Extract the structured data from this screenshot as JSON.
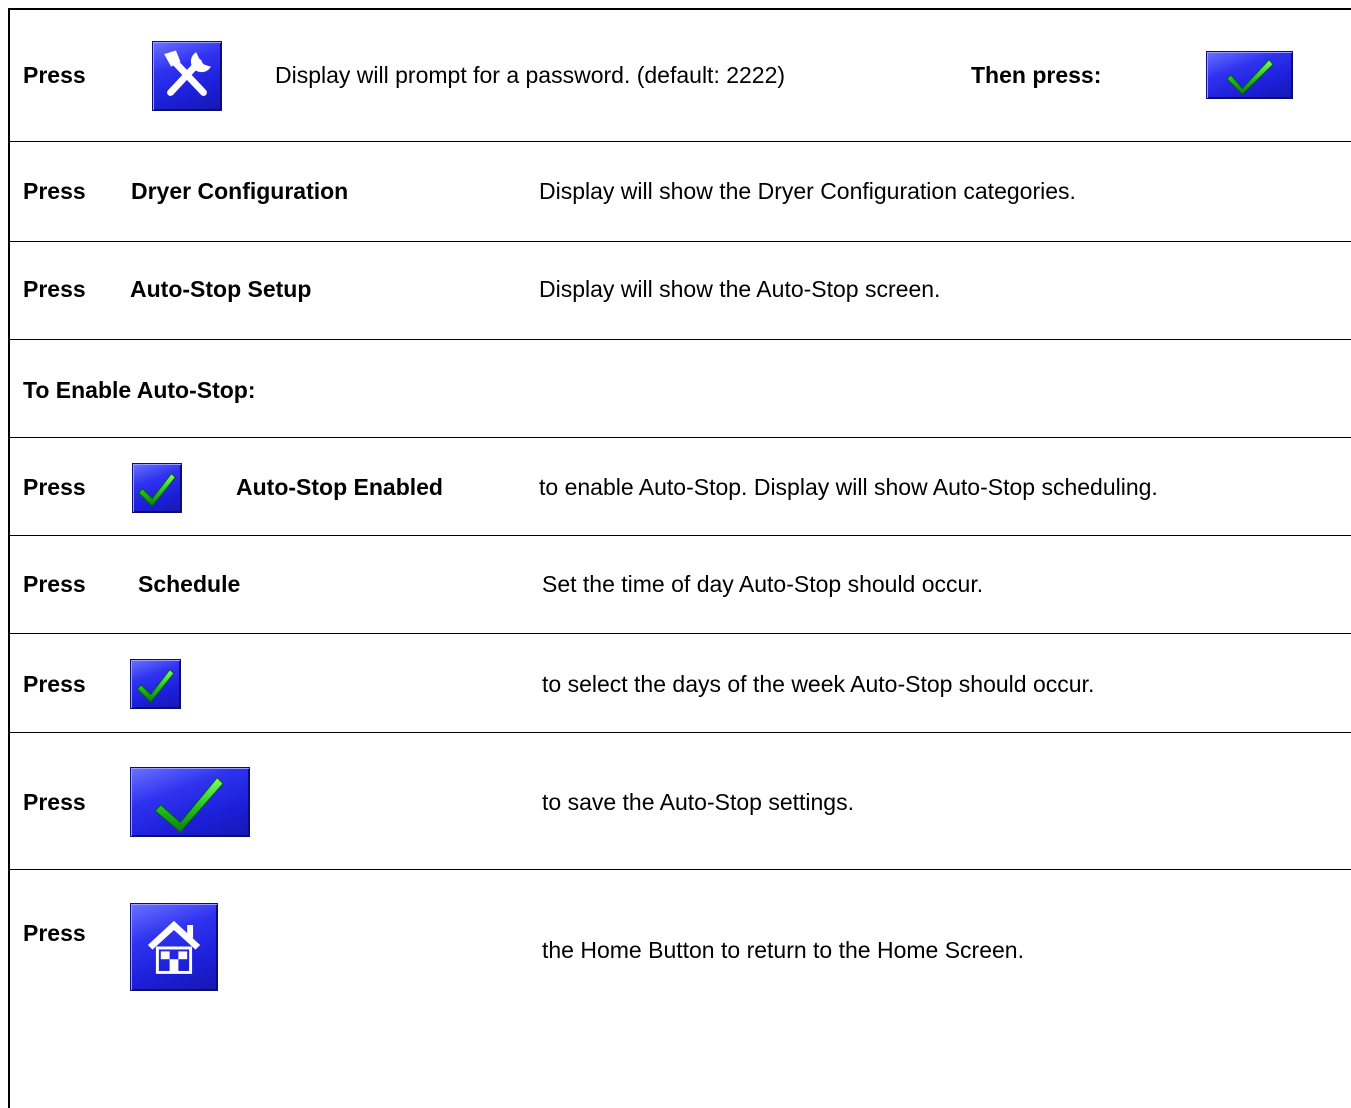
{
  "rows": [
    {
      "press": "Press",
      "desc": "Display will prompt for a password. (default: 2222)",
      "then_press": "Then press:"
    },
    {
      "press": "Press",
      "item": "Dryer Configuration",
      "desc": "Display will show the Dryer Configuration categories."
    },
    {
      "press": "Press",
      "item": "Auto-Stop Setup",
      "desc": "Display will show the Auto-Stop screen."
    },
    {
      "heading": "To Enable Auto-Stop:"
    },
    {
      "press": "Press",
      "item": "Auto-Stop Enabled",
      "desc": "to enable Auto-Stop.  Display will show Auto-Stop scheduling."
    },
    {
      "press": "Press",
      "item": "Schedule",
      "desc": "Set the time of day Auto-Stop should occur."
    },
    {
      "press": "Press",
      "desc": "to select the days of the week Auto-Stop should occur."
    },
    {
      "press": "Press",
      "desc": "to save the Auto-Stop settings."
    },
    {
      "press": "Press",
      "desc": "the Home Button to return to the Home Screen."
    }
  ],
  "icons": {
    "row1_left": "tools-icon",
    "row1_right": "checkmark-icon",
    "row5": "checkmark-icon",
    "row7": "checkmark-icon",
    "row8": "checkmark-icon",
    "row9": "home-icon"
  },
  "colors": {
    "button_blue": "#2f33f0",
    "check_green": "#22c222"
  }
}
